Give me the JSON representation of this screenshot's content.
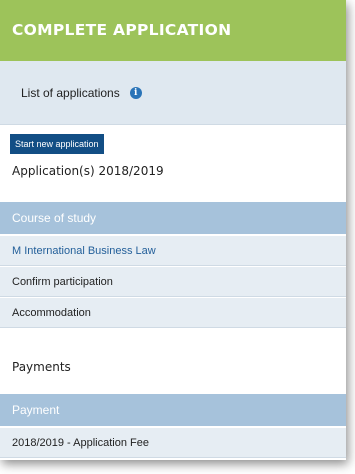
{
  "header": {
    "title": "COMPLETE APPLICATION"
  },
  "applications": {
    "list_label": "List of applications",
    "info_icon_glyph": "i",
    "start_button": "Start new application",
    "year_title": "Application(s) 2018/2019"
  },
  "course_table": {
    "header": "Course of study",
    "rows": [
      "M International Business Law",
      "Confirm participation",
      "Accommodation"
    ]
  },
  "payments": {
    "title": "Payments",
    "header": "Payment",
    "rows": [
      "2018/2019 - Application Fee"
    ]
  },
  "colors": {
    "header_green": "#9dc35a",
    "button_blue": "#124e85",
    "table_header_blue": "#a6c2db",
    "link_blue": "#24609a"
  }
}
